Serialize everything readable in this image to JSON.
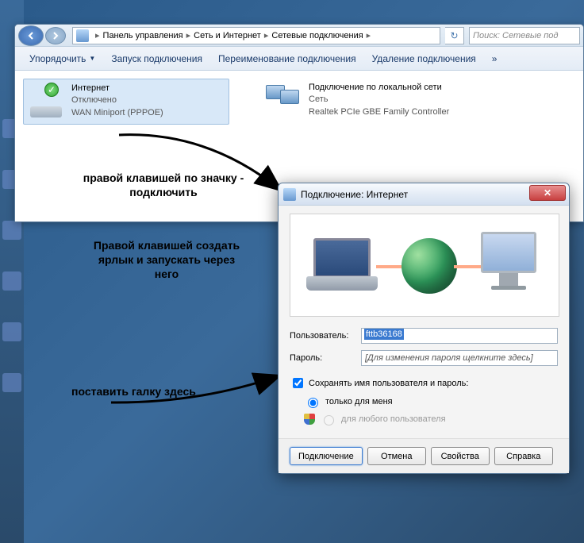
{
  "breadcrumb": {
    "items": [
      "Панель управления",
      "Сеть и Интернет",
      "Сетевые подключения"
    ]
  },
  "search": {
    "placeholder": "Поиск: Сетевые под"
  },
  "toolbar": {
    "organize": "Упорядочить",
    "start_conn": "Запуск подключения",
    "rename_conn": "Переименование подключения",
    "delete_conn": "Удаление подключения",
    "more": "»"
  },
  "connections": [
    {
      "name": "Интернет",
      "status": "Отключено",
      "device": "WAN Miniport (PPPOE)"
    },
    {
      "name": "Подключение по локальной сети",
      "status": "Сеть",
      "device": "Realtek PCIe GBE Family Controller"
    }
  ],
  "annotations": {
    "a1": "правой клавишей по значку - подключить",
    "a2": "Правой клавишей создать ярлык и запускать через него",
    "a3": "поставить галку здесь"
  },
  "dialog": {
    "title": "Подключение: Интернет",
    "user_label": "Пользователь:",
    "user_value": "fttb36168",
    "pass_label": "Пароль:",
    "pass_placeholder": "[Для изменения пароля щелкните здесь]",
    "save_label": "Сохранять имя пользователя и пароль:",
    "radio_me": "только для меня",
    "radio_all": "для любого пользователя",
    "buttons": {
      "connect": "Подключение",
      "cancel": "Отмена",
      "properties": "Свойства",
      "help": "Справка"
    }
  }
}
